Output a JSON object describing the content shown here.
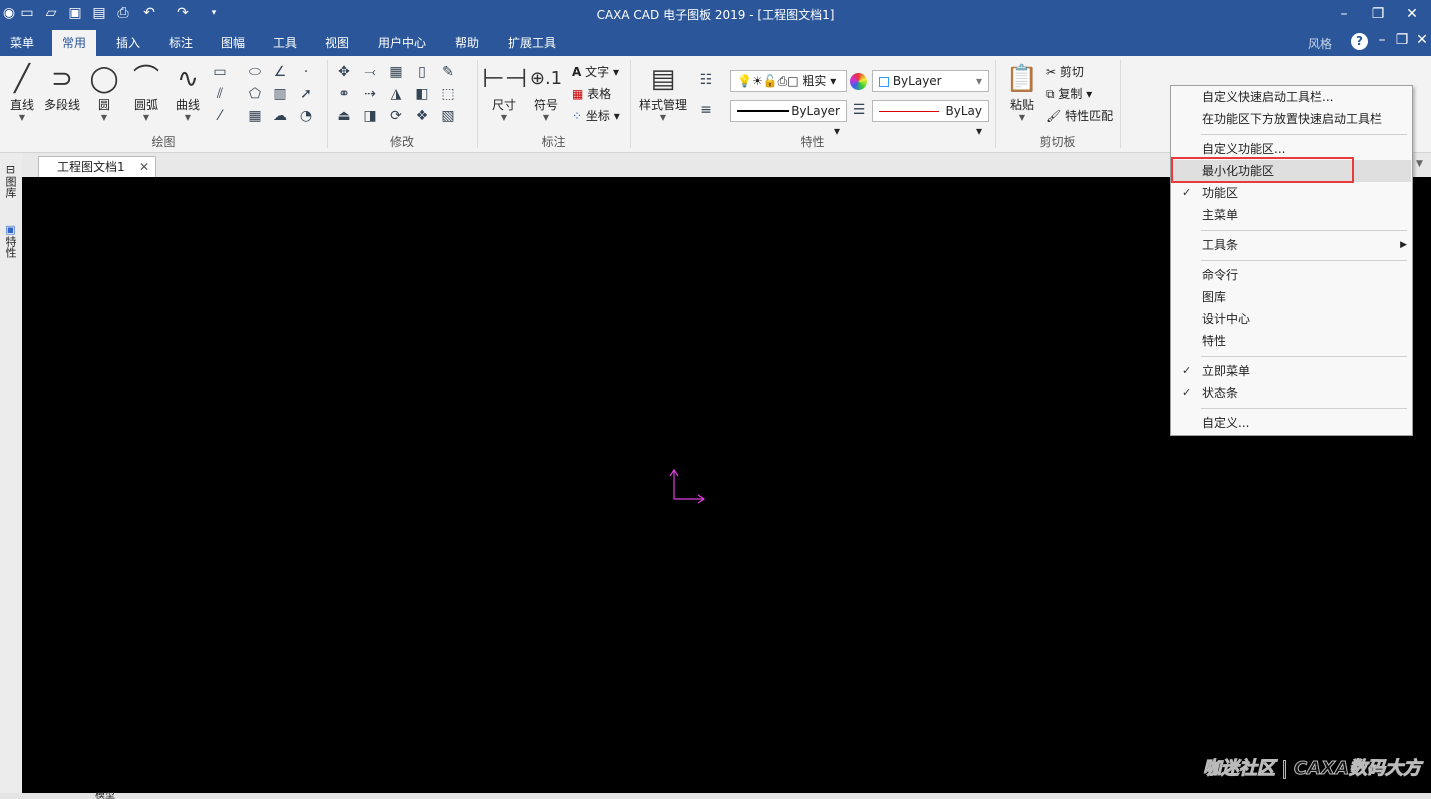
{
  "app": {
    "title": "CAXA CAD 电子图板 2019 - [工程图文档1]",
    "style_label": "风格"
  },
  "tabs": [
    "菜单",
    "常用",
    "插入",
    "标注",
    "图幅",
    "工具",
    "视图",
    "用户中心",
    "帮助",
    "扩展工具"
  ],
  "ribbon": {
    "draw": {
      "label": "绘图",
      "buttons": [
        "直线",
        "多段线",
        "圆",
        "圆弧",
        "曲线"
      ]
    },
    "modify": {
      "label": "修改"
    },
    "annotate": {
      "label": "标注",
      "buttons": [
        "尺寸",
        "符号"
      ],
      "small": [
        "文字",
        "表格",
        "坐标"
      ]
    },
    "properties": {
      "label": "特性",
      "style_manager": "样式管理",
      "layer_value": "粗实",
      "color_value": "ByLayer",
      "linewidth_value": "ByLayer",
      "linetype_value": "ByLay"
    },
    "clipboard": {
      "label": "剪切板",
      "paste": "粘贴",
      "cut": "剪切",
      "copy": "复制",
      "match": "特性匹配"
    }
  },
  "document_tab": "工程图文档1",
  "side_panels": [
    "图库",
    "特性"
  ],
  "bottom_tab": "模型",
  "watermark": "咖迷社区 | CAXA数码大方",
  "context_menu": [
    {
      "label": "自定义快速启动工具栏...",
      "checked": false
    },
    {
      "label": "在功能区下方放置快速启动工具栏",
      "checked": false
    },
    {
      "label": "自定义功能区...",
      "checked": false
    },
    {
      "label": "最小化功能区",
      "checked": false,
      "highlighted": true
    },
    {
      "label": "功能区",
      "checked": true
    },
    {
      "label": "主菜单",
      "checked": false
    },
    {
      "label": "工具条",
      "checked": false,
      "submenu": true
    },
    {
      "label": "命令行",
      "checked": false
    },
    {
      "label": "图库",
      "checked": false
    },
    {
      "label": "设计中心",
      "checked": false
    },
    {
      "label": "特性",
      "checked": false
    },
    {
      "label": "立即菜单",
      "checked": true
    },
    {
      "label": "状态条",
      "checked": true
    },
    {
      "label": "自定义...",
      "checked": false
    }
  ],
  "colors": {
    "titlebar": "#2b579a",
    "highlight_box": "#e83a3a",
    "axis": "#e040e0"
  }
}
